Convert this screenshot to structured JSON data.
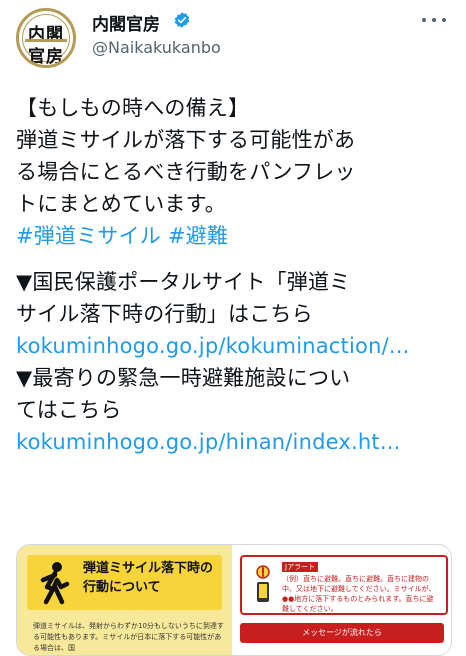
{
  "account": {
    "display_name": "内閣官房",
    "handle": "@Naikakukanbo",
    "verified": true,
    "avatar_text_top": "内閣",
    "avatar_text_bottom": "官房"
  },
  "tweet": {
    "lines": [
      "【もしもの時への備え】",
      "弾道ミサイルが落下する可能性があ",
      "る場合にとるべき行動をパンフレッ",
      "トにまとめています。"
    ],
    "hashtags": "#弾道ミサイル #避難",
    "portal_lines": [
      "▼国民保護ポータルサイト「弾道ミ",
      "サイル落下時の行動」はこちら"
    ],
    "portal_link": "kokuminhogo.go.jp/kokuminaction/...",
    "shelter_lines": [
      "▼最寄りの緊急一時避難施設につい",
      "てはこちら"
    ],
    "shelter_link": "kokuminhogo.go.jp/hinan/index.ht..."
  },
  "card": {
    "title_line1": "弾道ミサイル落下時の",
    "title_line2": "行動について",
    "description": "弾道ミサイルは、発射からわずか10分もしないうちに到達する可能性もあります。ミサイルが日本に落下する可能性がある場合は、国",
    "alert_tag": "Jアラート",
    "alert_text": "（例）直ちに避難。直ちに避難。直ちに建物の中、又は地下に避難してください。ミサイルが、●●地方に落下するものとみられます。直ちに避難してください。",
    "message_bar": "メッセージが流れたら"
  },
  "colors": {
    "link": "#1d9bf0",
    "text": "#0f1419",
    "secondary": "#536471",
    "verified": "#1d9bf0",
    "card_yellow": "#f6d43a",
    "alert_red": "#c81e1e"
  }
}
